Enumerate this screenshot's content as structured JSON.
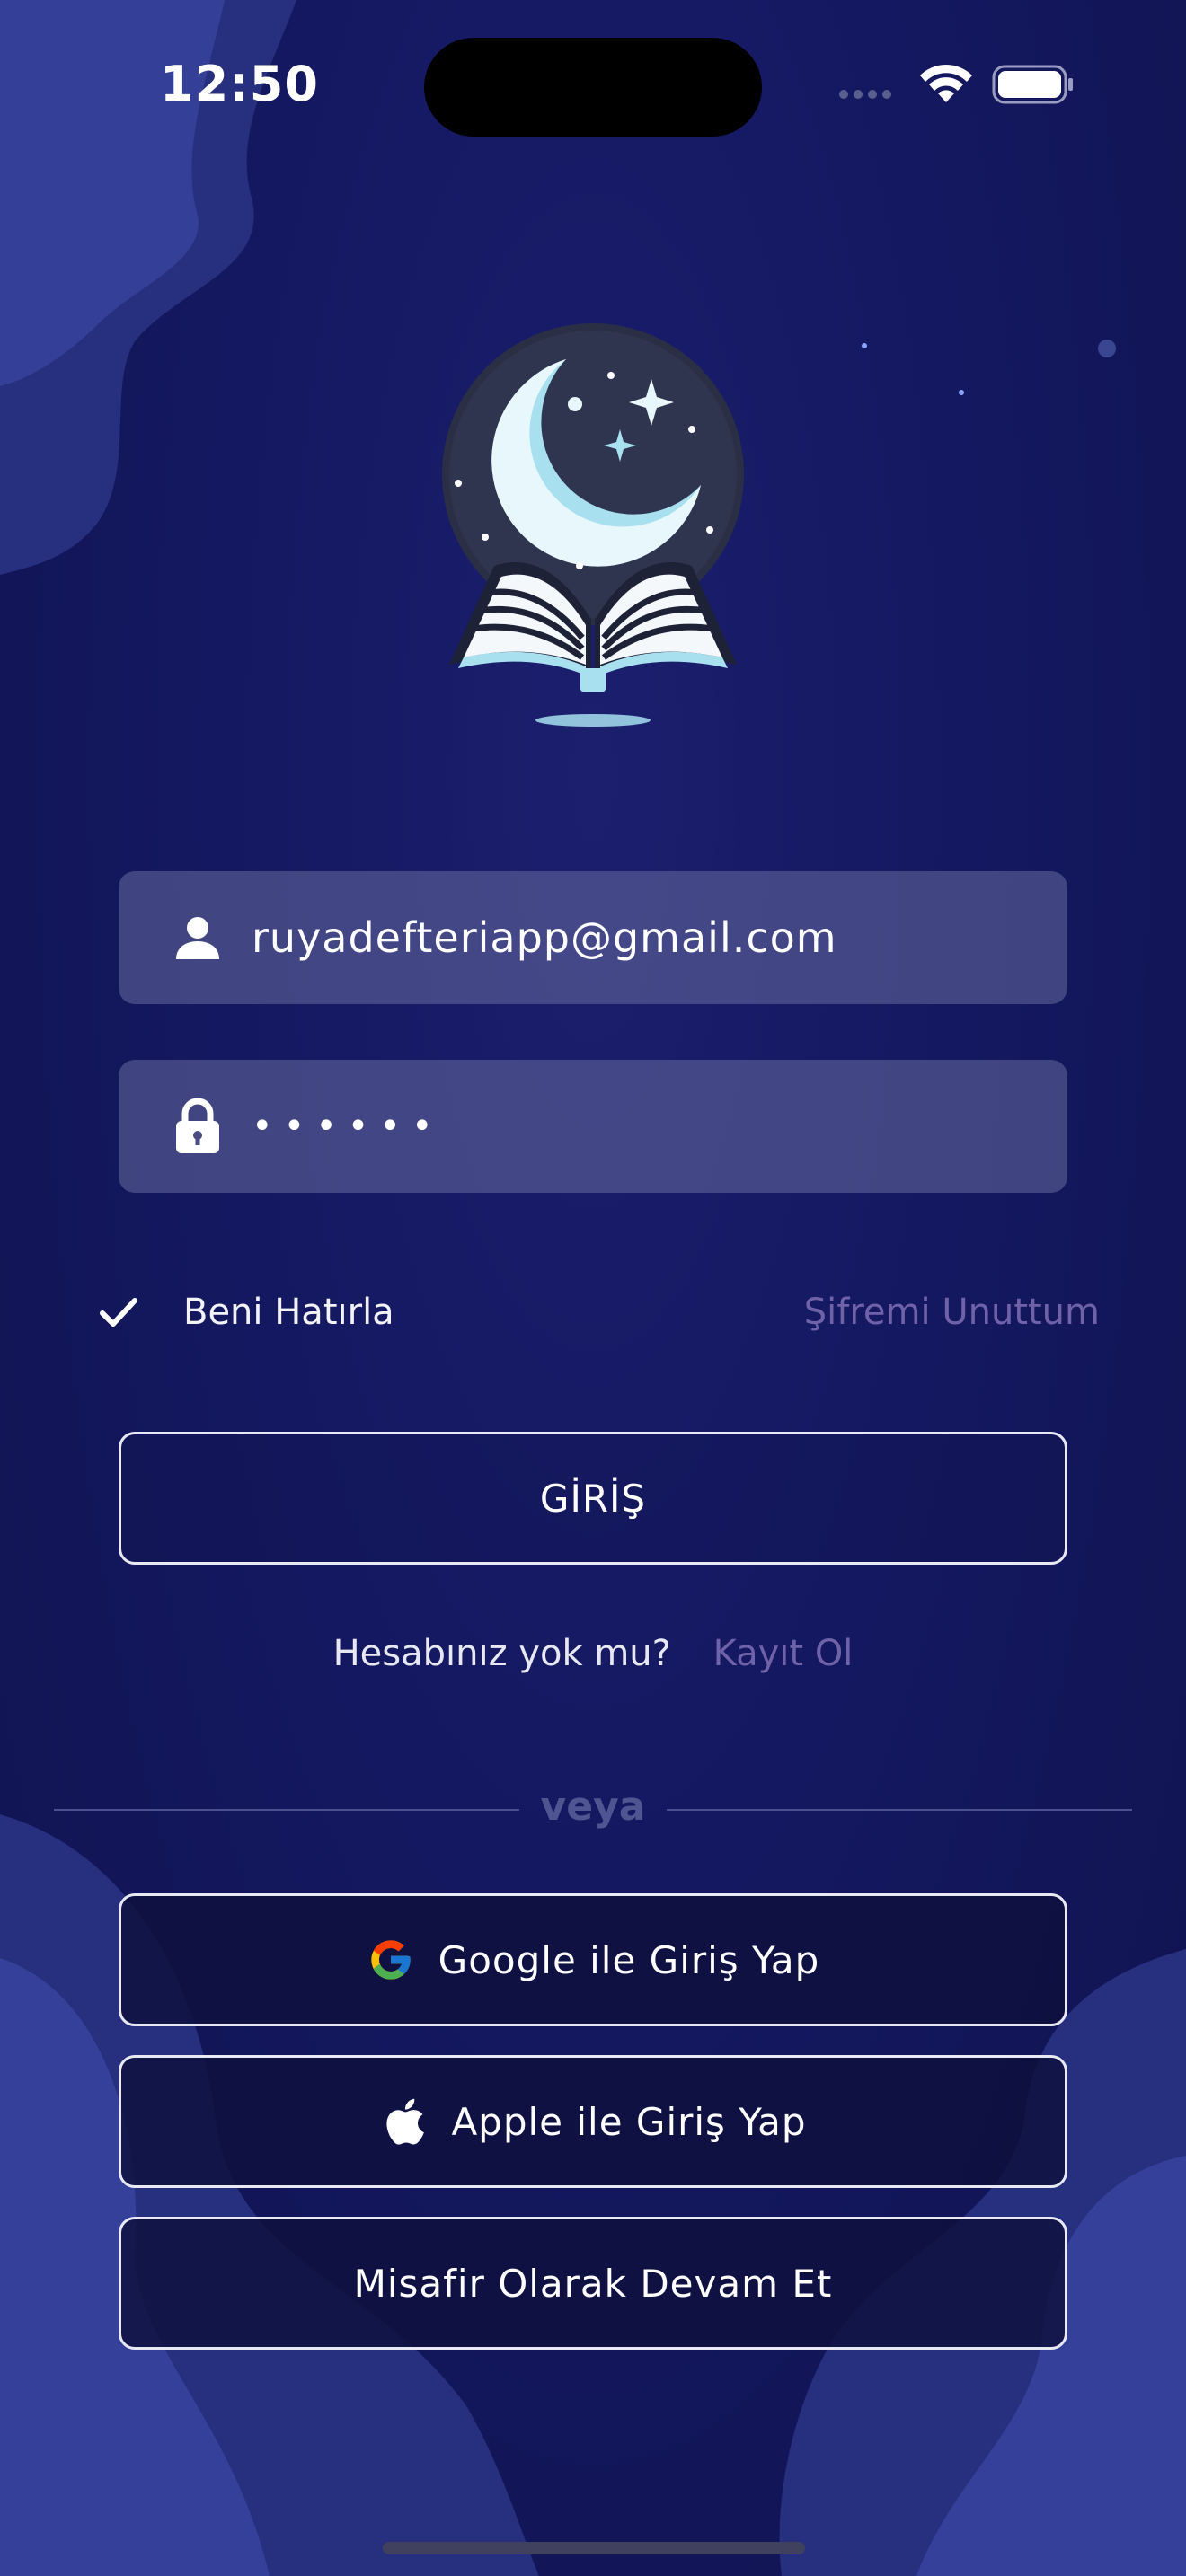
{
  "status_bar": {
    "time": "12:50"
  },
  "login_form": {
    "email_value": "ruyadefteriapp@gmail.com",
    "password_value": "••••••",
    "remember_label": "Beni Hatırla",
    "remember_checked": true,
    "forgot_label": "Şifremi Unuttum",
    "login_label": "GİRİŞ"
  },
  "signup": {
    "question": "Hesabınız yok mu?",
    "link_label": "Kayıt Ol"
  },
  "divider_label": "veya",
  "social": {
    "google_label": "Google ile Giriş Yap",
    "apple_label": "Apple ile Giriş Yap",
    "guest_label": "Misafir Olarak Devam Et"
  },
  "colors": {
    "background": "#141860",
    "input_fill": "#4a4d82",
    "link": "#6f62a8",
    "logo_accent": "#a8e0f0"
  },
  "icons": [
    "user-icon",
    "lock-icon",
    "check-icon",
    "google-icon",
    "apple-icon",
    "wifi-icon",
    "battery-icon"
  ]
}
